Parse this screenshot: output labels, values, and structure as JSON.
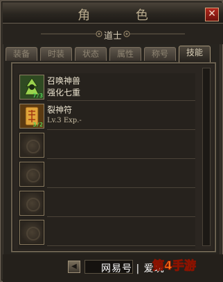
{
  "window": {
    "title": "角 色",
    "close_label": "✕"
  },
  "character": {
    "class_name": "道士"
  },
  "tabs": [
    {
      "label": "装备",
      "active": false
    },
    {
      "label": "时装",
      "active": false
    },
    {
      "label": "状态",
      "active": false
    },
    {
      "label": "属性",
      "active": false
    },
    {
      "label": "称号",
      "active": false
    },
    {
      "label": "技能",
      "active": true
    }
  ],
  "skills": [
    {
      "name": "召唤神兽",
      "sub": "强化七重",
      "badge": "7/3",
      "icon": "summon-beast-icon"
    },
    {
      "name": "裂神符",
      "level": "Lv.3  Exp.-",
      "badge": "3/2",
      "icon": "talisman-icon"
    },
    {
      "icon": "empty-slot-icon"
    },
    {
      "icon": "empty-slot-icon"
    },
    {
      "icon": "empty-slot-icon"
    },
    {
      "icon": "empty-slot-icon"
    }
  ],
  "pager": {
    "prev_label": "◀"
  },
  "watermark": {
    "text": "网易号 | 爱玩",
    "logo": "第4手游"
  },
  "colors": {
    "frame": "#27241f",
    "accent_gold": "#8d7e63",
    "close_red": "#b2281d",
    "badge_green": "#56d65a"
  }
}
